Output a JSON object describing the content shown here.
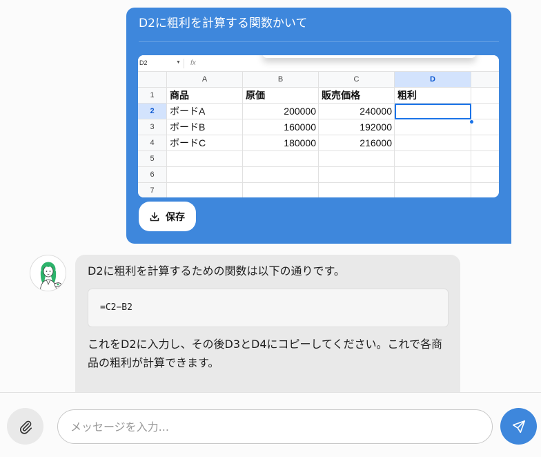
{
  "user_message": {
    "text": "D2に粗利を計算する関数かいて",
    "attachment": {
      "cell_ref": "D2",
      "fx_label": "fx",
      "column_headers": [
        "A",
        "B",
        "C",
        "D"
      ],
      "rows": [
        {
          "num": "1",
          "cells": [
            "商品",
            "原価",
            "販売価格",
            "粗利"
          ]
        },
        {
          "num": "2",
          "cells": [
            "ボードA",
            "200000",
            "240000",
            ""
          ]
        },
        {
          "num": "3",
          "cells": [
            "ボードB",
            "160000",
            "192000",
            ""
          ]
        },
        {
          "num": "4",
          "cells": [
            "ボードC",
            "180000",
            "216000",
            ""
          ]
        },
        {
          "num": "5",
          "cells": [
            "",
            "",
            "",
            ""
          ]
        },
        {
          "num": "6",
          "cells": [
            "",
            "",
            "",
            ""
          ]
        },
        {
          "num": "7",
          "cells": [
            "",
            "",
            "",
            ""
          ]
        }
      ],
      "selected_cell": "D2",
      "save_label": "保存"
    }
  },
  "assistant_message": {
    "intro": "D2に粗利を計算するための関数は以下の通りです。",
    "code": "=C2−B2",
    "follow_up": "これをD2に入力し、その後D3とD4にコピーしてください。これで各商品の粗利が計算できます。"
  },
  "composer": {
    "placeholder": "メッセージを入力...",
    "value": "",
    "attach_icon": "paperclip-icon",
    "send_icon": "send-icon"
  },
  "colors": {
    "user_bubble": "#3e87dc",
    "assistant_bubble": "#e9e9e9",
    "send_button": "#3e87dc",
    "selected_column_header": "#d3e3fd"
  }
}
